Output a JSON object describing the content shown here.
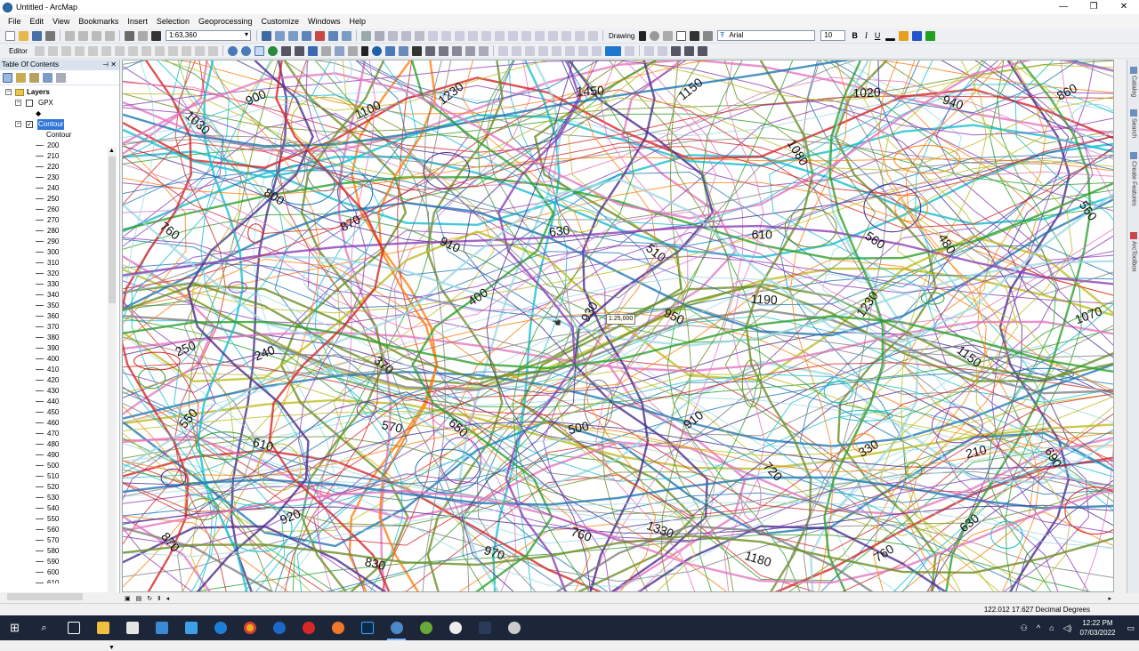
{
  "window": {
    "title": "Untitled - ArcMap",
    "minimize": "—",
    "maximize": "❐",
    "close": "✕"
  },
  "menu": [
    "File",
    "Edit",
    "View",
    "Bookmarks",
    "Insert",
    "Selection",
    "Geoprocessing",
    "Customize",
    "Windows",
    "Help"
  ],
  "toolbar": {
    "scale": "1:63,360",
    "drawing_label": "Drawing",
    "font_name": "Arial",
    "font_size": "10",
    "bold": "B",
    "italic": "I",
    "underline": "U",
    "editor_label": "Editor"
  },
  "toc": {
    "title": "Table Of Contents",
    "pin": "⊣",
    "close": "✕",
    "root": "Layers",
    "layers": [
      {
        "name": "GPX",
        "checked": false
      },
      {
        "name": "Contour",
        "checked": true,
        "selected": true
      }
    ],
    "field_name": "Contour",
    "legend_values": [
      "200",
      "210",
      "220",
      "230",
      "240",
      "250",
      "260",
      "270",
      "280",
      "290",
      "300",
      "310",
      "320",
      "330",
      "340",
      "350",
      "360",
      "370",
      "380",
      "390",
      "400",
      "410",
      "420",
      "430",
      "440",
      "450",
      "460",
      "470",
      "480",
      "490",
      "500",
      "510",
      "520",
      "530",
      "540",
      "550",
      "560",
      "570",
      "580",
      "590",
      "600",
      "610"
    ]
  },
  "map": {
    "scale_tooltip": "1:25,000",
    "contour_labels": [
      "1030",
      "900",
      "1100",
      "1230",
      "1450",
      "1150",
      "1080",
      "1020",
      "940",
      "860",
      "760",
      "800",
      "870",
      "910",
      "630",
      "510",
      "610",
      "560",
      "480",
      "560",
      "250",
      "240",
      "370",
      "400",
      "930",
      "950",
      "1190",
      "1230",
      "1150",
      "1070",
      "550",
      "610",
      "570",
      "650",
      "500",
      "910",
      "720",
      "330",
      "210",
      "690",
      "870",
      "920",
      "830",
      "970",
      "760",
      "1330",
      "1180",
      "760",
      "630"
    ],
    "line_colors": [
      "#2ca02c",
      "#1f77b4",
      "#17becf",
      "#8c3fb5",
      "#d62728",
      "#e377c2",
      "#bcbd22",
      "#ff7f0e",
      "#7f7f7f",
      "#9edae5",
      "#6b8e23",
      "#4a2c8f"
    ]
  },
  "dock_tabs": [
    "Catalog",
    "Search",
    "Create Features",
    "ArcToolbox"
  ],
  "status": {
    "coordinates": "122.012  17.627 Decimal Degrees"
  },
  "taskbar": {
    "apps": [
      "start",
      "search",
      "task-view",
      "file-explorer",
      "store",
      "mail",
      "onedrive",
      "edge",
      "chrome",
      "vivaldi",
      "opera",
      "firefox",
      "photoshop",
      "arcmap",
      "qgis",
      "settings",
      "terminal",
      "media"
    ],
    "time": "12:22 PM",
    "date": "07/03/2022"
  }
}
